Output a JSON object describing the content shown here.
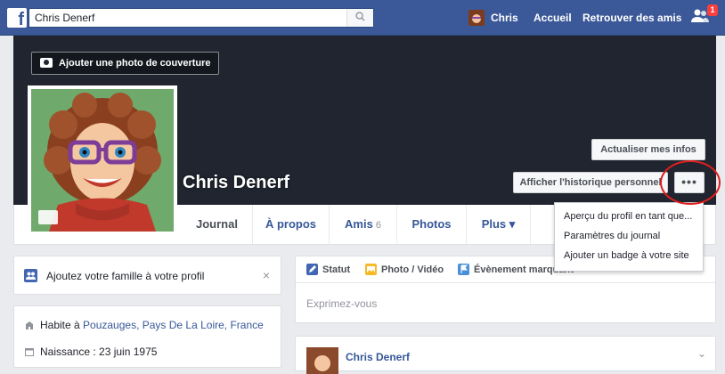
{
  "colors": {
    "brand": "#3b5998",
    "cover": "#20252f",
    "link": "#365899",
    "highlight": "#e01f1f"
  },
  "topbar": {
    "logo": "f",
    "search_value": "Chris Denerf",
    "search_icon": "search-icon",
    "user_name": "Chris",
    "home_label": "Accueil",
    "find_friends_label": "Retrouver des amis",
    "friend_requests_count": "1"
  },
  "cover": {
    "add_cover_label": "Ajouter une photo de couverture",
    "profile_name": "Chris Denerf",
    "update_info_label": "Actualiser mes infos",
    "activity_log_label": "Afficher l'historique personnel",
    "more_label": "•••"
  },
  "tabs": [
    {
      "label": "Journal"
    },
    {
      "label": "À propos"
    },
    {
      "label": "Amis",
      "count": "6"
    },
    {
      "label": "Photos"
    },
    {
      "label": "Plus ▾"
    }
  ],
  "dropdown": {
    "items": [
      "Aperçu du profil en tant que...",
      "Paramètres du journal",
      "Ajouter un badge à votre site"
    ]
  },
  "sidebar": {
    "family_prompt": "Ajoutez votre famille à votre profil",
    "close": "×",
    "lives_prefix": "Habite à ",
    "lives_place": "Pouzauges, Pays De La Loire, France",
    "birth": "Naissance : 23 juin 1975"
  },
  "composer": {
    "status_label": "Statut",
    "photo_label": "Photo / Vidéo",
    "event_label": "Évènement marquant",
    "placeholder": "Exprimez-vous"
  },
  "post": {
    "author": "Chris Denerf",
    "chevron": "⌄"
  }
}
